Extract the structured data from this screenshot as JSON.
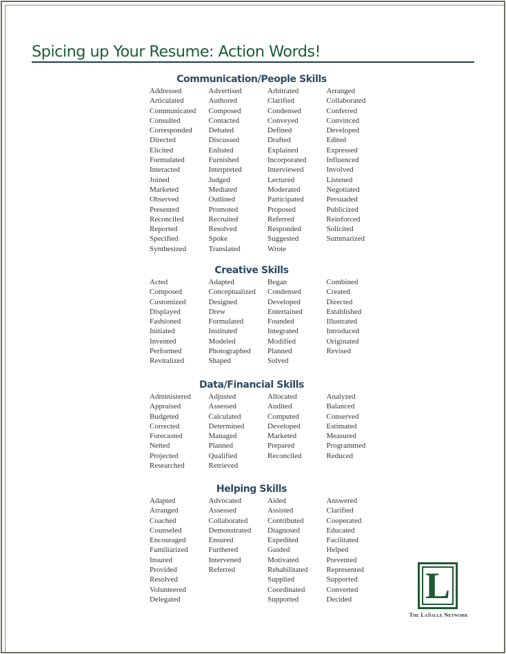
{
  "title": "Spicing up Your Resume: Action Words!",
  "sections": [
    {
      "heading": "Communication/People Skills",
      "rows": [
        [
          "Addressed",
          "Advertised",
          "Arbitrated",
          " Arranged"
        ],
        [
          "Articulated",
          "Authored",
          "Clarified",
          "Collaborated"
        ],
        [
          "Communicated",
          "Composed",
          "Condensed",
          "Conferred"
        ],
        [
          "Consulted",
          "Contacted",
          "Conveyed",
          "Convinced"
        ],
        [
          "Corresponded",
          "Debated",
          "Defined",
          "Developed"
        ],
        [
          "Directed",
          "Discussed",
          "Drafted",
          "Edited"
        ],
        [
          "Elicited",
          "Enlisted",
          "Explained",
          "Expressed"
        ],
        [
          "Formulated",
          "Furnished",
          "Incorporated",
          "Influenced"
        ],
        [
          "Interacted",
          "Interpreted",
          "Interviewed",
          "Involved"
        ],
        [
          "Joined",
          "Judged",
          "Lectured",
          "Listened"
        ],
        [
          "Marketed",
          "Mediated",
          "Moderated",
          "Negotiated"
        ],
        [
          "Observed",
          "Outlined",
          "Participated",
          "Persuaded"
        ],
        [
          "Presented",
          "Promoted",
          "Proposed",
          "Publicized"
        ],
        [
          "Reconciled",
          "Recruited",
          "Referred",
          "Reinforced"
        ],
        [
          "Reported",
          "Resolved",
          "Responded",
          "Solicited"
        ],
        [
          "Specified",
          "Spoke",
          "Suggested",
          "Summarized"
        ],
        [
          "Synthesized",
          "Translated",
          "Wrote",
          ""
        ]
      ]
    },
    {
      "heading": "Creative Skills",
      "rows": [
        [
          "Acted",
          "Adapted",
          "Began",
          "Combined"
        ],
        [
          "Composed",
          "Conceptualized",
          "Condensed",
          "Created"
        ],
        [
          "Customized",
          "Designed",
          "Developed",
          "Directed"
        ],
        [
          "Displayed",
          "Drew",
          "Entertained",
          "Established"
        ],
        [
          "Fashioned",
          "Formulated",
          "Founded",
          "Illustrated"
        ],
        [
          "Initiated",
          "Instituted",
          "Integrated",
          "Introduced"
        ],
        [
          "Invented",
          "Modeled",
          "Modified",
          "Originated"
        ],
        [
          "Performed",
          "Photographed",
          "Planned",
          "Revised"
        ],
        [
          "Revitalized",
          "Shaped",
          "Solved",
          ""
        ]
      ]
    },
    {
      "heading": "Data/Financial Skills",
      "rows": [
        [
          "Administered",
          "Adjusted",
          "Allocated",
          "Analyzed"
        ],
        [
          "Appraised",
          "Assessed",
          "Audited",
          "Balanced"
        ],
        [
          "Budgeted",
          "Calculated",
          "Computed",
          "Conserved"
        ],
        [
          "Corrected",
          "Determined",
          "Developed",
          "Estimated"
        ],
        [
          "Forecasted",
          "Managed",
          "Marketed",
          "Measured"
        ],
        [
          "Netted",
          "Planned",
          "Prepared",
          "Programmed"
        ],
        [
          "Projected",
          "Qualified",
          "Reconciled",
          "Reduced"
        ],
        [
          "Researched",
          "Retrieved",
          "",
          ""
        ]
      ]
    },
    {
      "heading": "Helping Skills",
      "rows": [
        [
          "Adapted",
          "Advocated",
          "Aided",
          "Answered"
        ],
        [
          "Arranged",
          "Assessed",
          "Assisted",
          "Clarified"
        ],
        [
          "Coached",
          "Collaborated",
          "Contributed",
          "Cooperated"
        ],
        [
          "Counseled",
          "Demonstrated",
          "Diagnosed",
          "Educated"
        ],
        [
          "Encouraged",
          "Ensured",
          "Expedited",
          "Facilitated"
        ],
        [
          "Familiarized",
          "Furthered",
          "Guided",
          "Helped"
        ],
        [
          "Insured",
          "Intervened",
          "Motivated",
          "Prevented"
        ],
        [
          "Provided",
          "Referred",
          "Rehabilitated",
          "Represented"
        ],
        [
          "Resolved",
          "",
          "Supplied",
          "Supported"
        ],
        [
          "Volunteered",
          "",
          "Coordinated",
          "Converted"
        ],
        [
          "Delegated",
          "",
          "Supported",
          "Decided"
        ]
      ]
    }
  ],
  "logo": {
    "letter": "L",
    "name": "The LaSalle Network",
    "brand_color": "#1e5a33"
  },
  "colors": {
    "title": "#1b5e35",
    "heading": "#2e4a62",
    "rule": "#1e3f44",
    "body_text": "#333333"
  }
}
